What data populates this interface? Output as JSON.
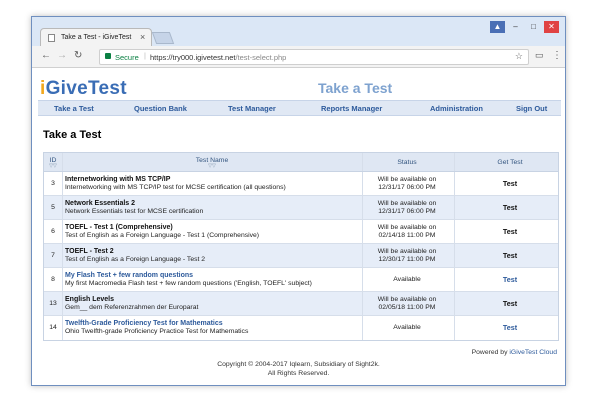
{
  "browser": {
    "tab_title": "Take a Test - iGiveTest",
    "tab_close": "×",
    "secure_label": "Secure",
    "url_host": "https://try000.igivetest.net",
    "url_path": "/test-select.php"
  },
  "site": {
    "logo_i": "i",
    "logo_rest": "GiveTest",
    "title": "Take a Test"
  },
  "nav": [
    "Take a Test",
    "Question Bank",
    "Test Manager",
    "Reports Manager",
    "Administration",
    "Sign Out"
  ],
  "heading": "Take a Test",
  "table": {
    "headers": {
      "id": "ID",
      "name": "Test Name",
      "status": "Status",
      "get": "Get Test"
    },
    "rows": [
      {
        "id": "3",
        "name": "Internetworking with MS TCP/IP",
        "desc": "Internetworking with MS TCP/IP test for MCSE certification (all questions)",
        "status": "Will be available on 12/31/17 06:00 PM",
        "get": "Test",
        "link": false
      },
      {
        "id": "5",
        "name": "Network Essentials 2",
        "desc": "Network Essentials test for MCSE certification",
        "status": "Will be available on 12/31/17 06:00 PM",
        "get": "Test",
        "link": false
      },
      {
        "id": "6",
        "name": "TOEFL - Test 1 (Comprehensive)",
        "desc": "Test of English as a Foreign Language - Test 1 (Comprehensive)",
        "status": "Will be available on 02/14/18 11:00 PM",
        "get": "Test",
        "link": false
      },
      {
        "id": "7",
        "name": "TOEFL - Test 2",
        "desc": "Test of English as a Foreign Language - Test 2",
        "status": "Will be available on 12/30/17 11:00 PM",
        "get": "Test",
        "link": false
      },
      {
        "id": "8",
        "name": "My Flash Test + few random questions",
        "desc": "My first Macromedia Flash test + few random questions ('English, TOEFL' subject)",
        "status": "Available",
        "get": "Test",
        "link": true
      },
      {
        "id": "13",
        "name": "English Levels",
        "desc": "Gem__ dem Referenzrahmen der Europarat",
        "status": "Will be available on 02/05/18 11:00 PM",
        "get": "Test",
        "link": false
      },
      {
        "id": "14",
        "name": "Twelfth-Grade Proficiency Test for Mathematics",
        "desc": "Ohio Twelfth-grade Proficiency Practice Test for Mathematics",
        "status": "Available",
        "get": "Test",
        "link": true
      }
    ]
  },
  "footer": {
    "powered_prefix": "Powered by",
    "powered_link": "iGiveTest Cloud",
    "copyright": "Copyright © 2004-2017 Iqlearn, Subsidiary of Sight2k.",
    "rights": "All Rights Reserved."
  },
  "colors": {
    "accent": "#2d5a9b",
    "logo_i": "#f2a81d",
    "row_alt": "#e6edf8"
  }
}
